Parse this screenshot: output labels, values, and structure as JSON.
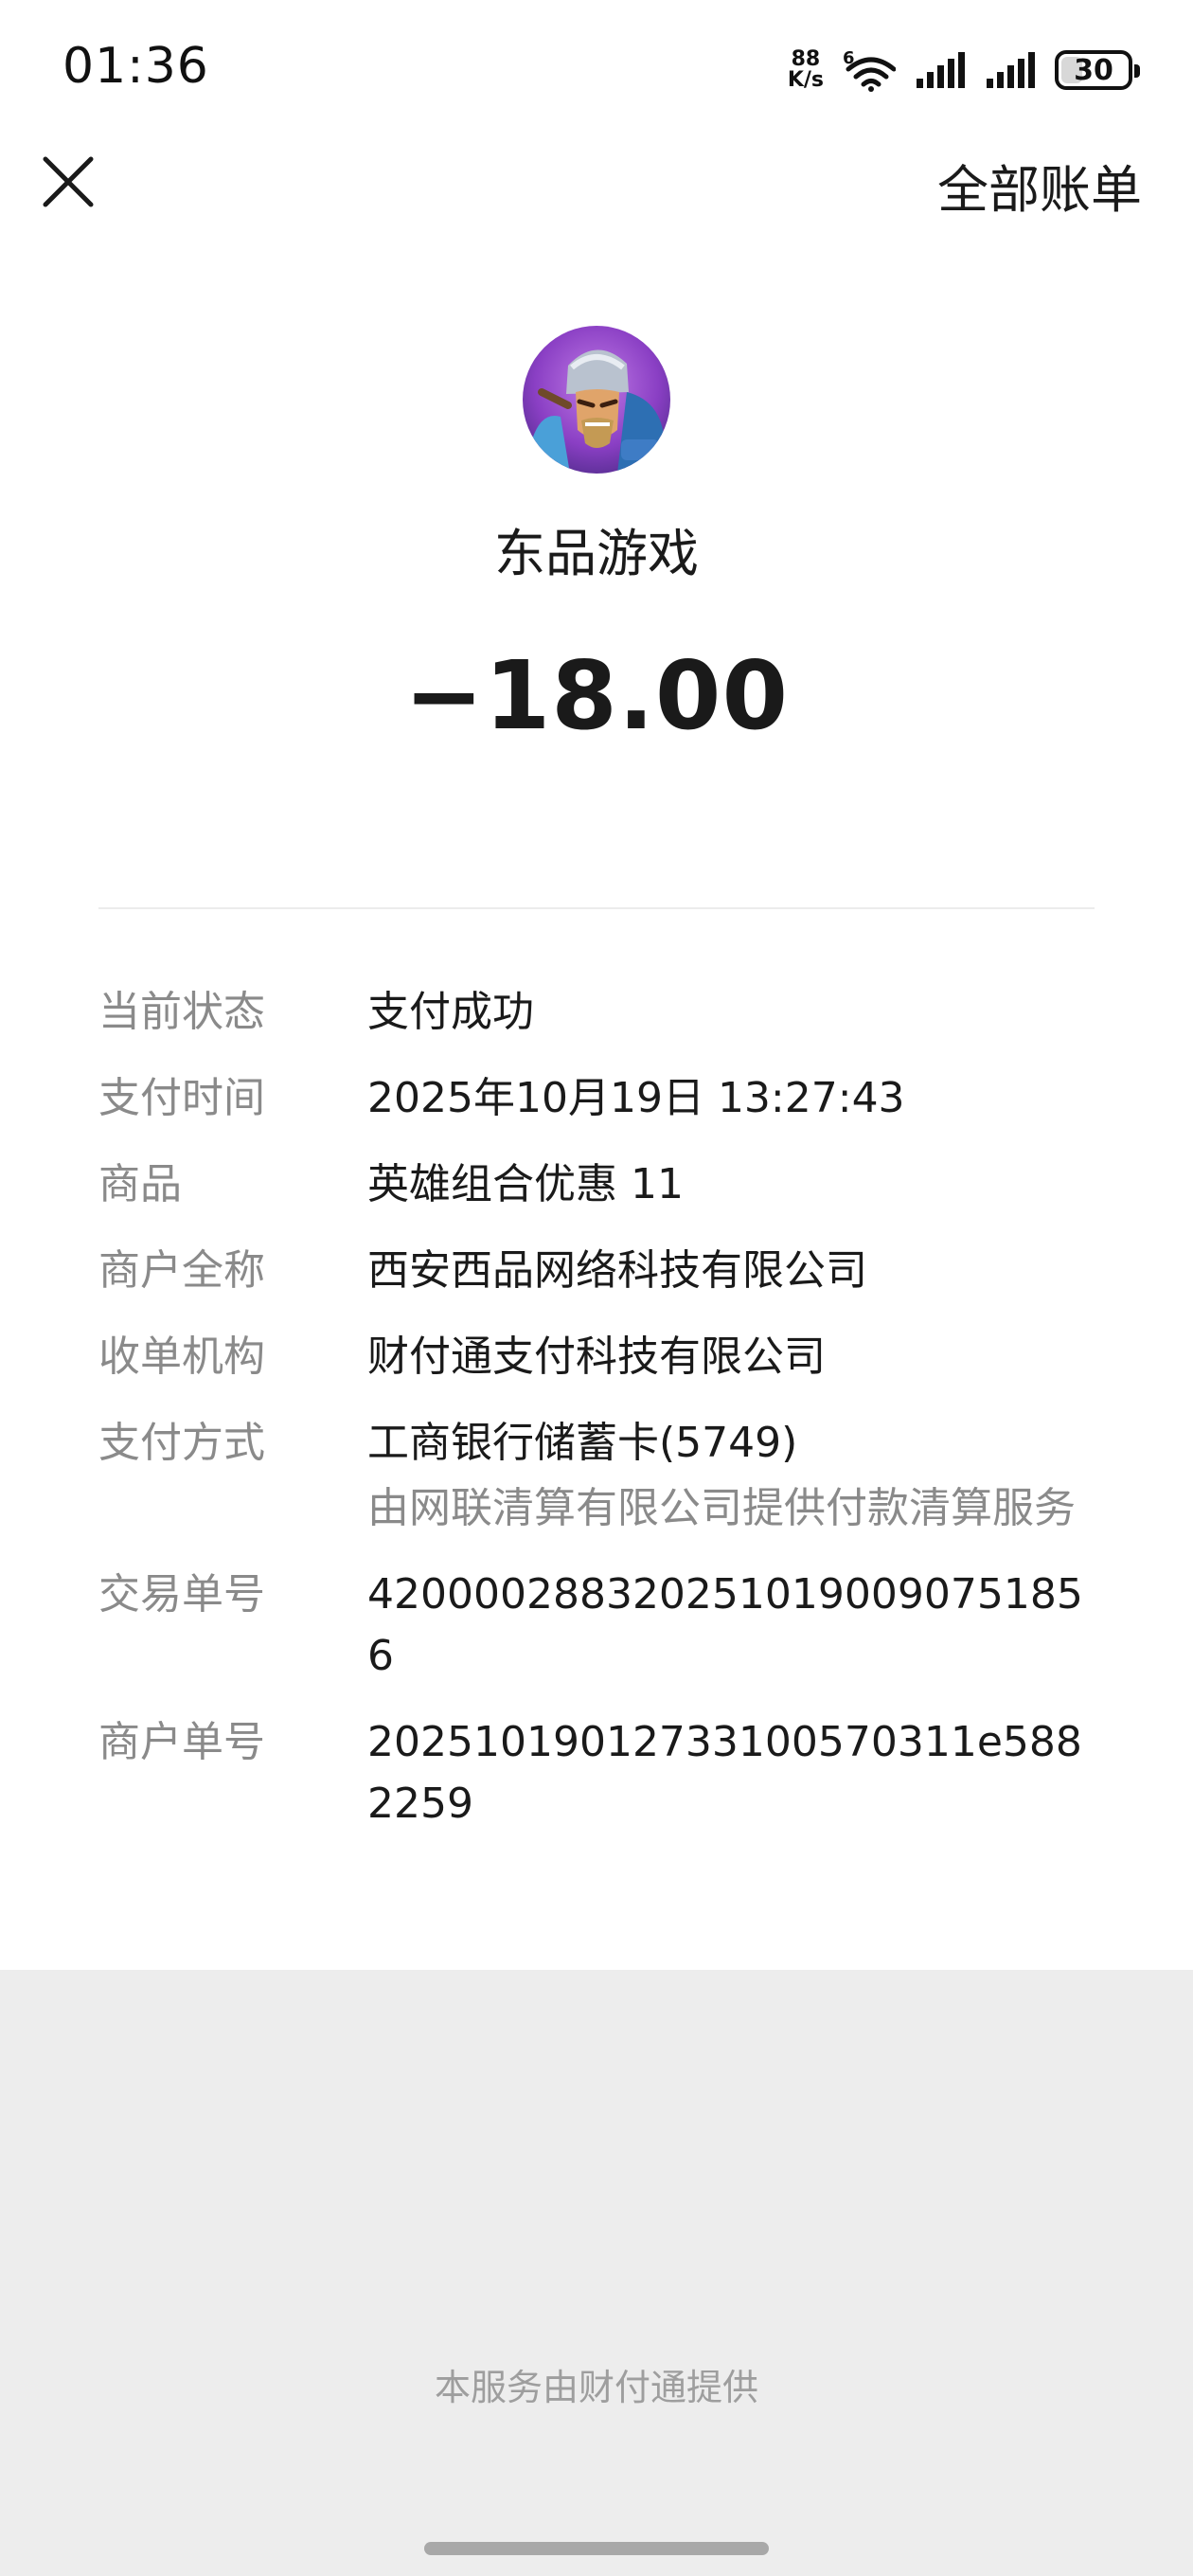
{
  "status_bar": {
    "time": "01:36",
    "net_speed_value": "88",
    "net_speed_unit": "K/s",
    "wifi_label": "6",
    "battery_level": "30"
  },
  "nav": {
    "all_bills_label": "全部账单"
  },
  "merchant": {
    "name": "东品游戏",
    "amount": "−18.00"
  },
  "details": [
    {
      "label": "当前状态",
      "value": "支付成功"
    },
    {
      "label": "支付时间",
      "value": "2025年10月19日 13:27:43"
    },
    {
      "label": "商品",
      "value": "英雄组合优惠 11"
    },
    {
      "label": "商户全称",
      "value": "西安西品网络科技有限公司"
    },
    {
      "label": "收单机构",
      "value": "财付通支付科技有限公司"
    },
    {
      "label": "支付方式",
      "value": "工商银行储蓄卡(5749)",
      "sub": "由网联清算有限公司提供付款清算服务"
    },
    {
      "label": "交易单号",
      "value": "4200002883202510190090751856"
    },
    {
      "label": "商户单号",
      "value": "20251019012733100570311e5882259"
    }
  ],
  "footer": {
    "provider_text": "本服务由财付通提供"
  },
  "colors": {
    "background": "#ededed",
    "card": "#ffffff",
    "label_gray": "#8a8a8a",
    "text_dark": "#1a1a1a"
  },
  "icons": [
    "close-icon",
    "wifi-icon",
    "signal-icon",
    "battery-icon",
    "merchant-avatar"
  ]
}
